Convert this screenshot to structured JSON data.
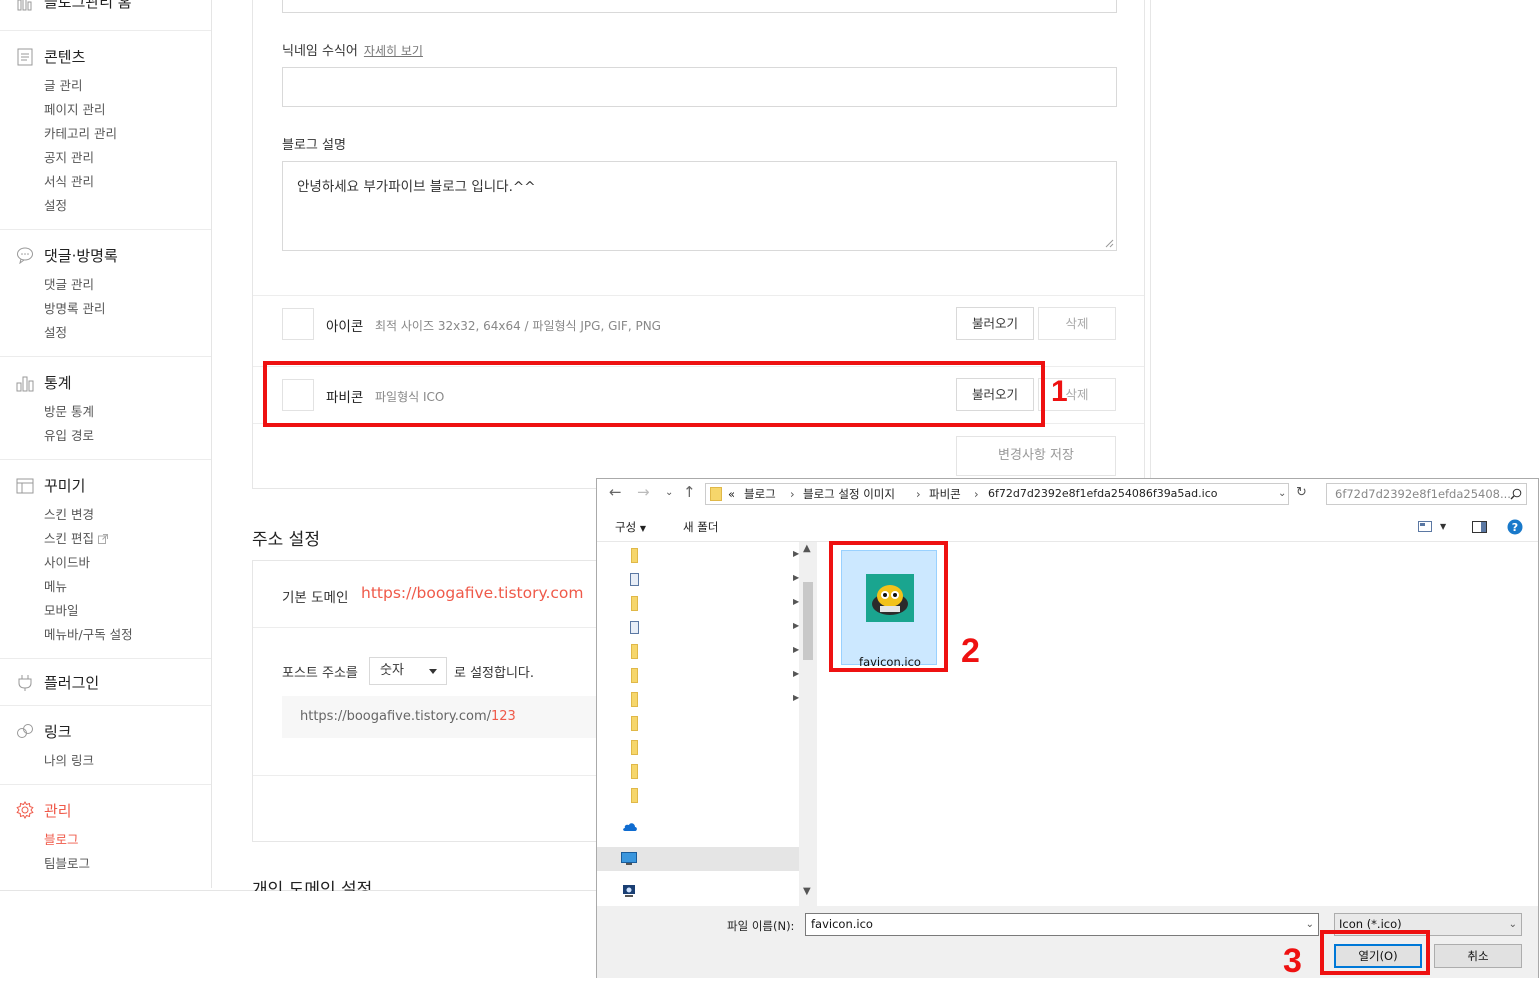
{
  "sidebar": {
    "top_cut_label": "블로그관리 홈",
    "sections": {
      "contents": {
        "title": "콘텐츠",
        "items": [
          "글 관리",
          "페이지 관리",
          "카테고리 관리",
          "공지 관리",
          "서식 관리",
          "설정"
        ]
      },
      "comments": {
        "title": "댓글·방명록",
        "items": [
          "댓글 관리",
          "방명록 관리",
          "설정"
        ]
      },
      "stats": {
        "title": "통계",
        "items": [
          "방문 통계",
          "유입 경로"
        ]
      },
      "decorate": {
        "title": "꾸미기",
        "items": [
          "스킨 변경",
          "스킨 편집",
          "사이드바",
          "메뉴",
          "모바일",
          "메뉴바/구독 설정"
        ]
      },
      "plugin": {
        "title": "플러그인"
      },
      "link": {
        "title": "링크",
        "items": [
          "나의 링크"
        ]
      },
      "manage": {
        "title": "관리",
        "items": [
          "블로그",
          "팀블로그"
        ]
      }
    }
  },
  "main": {
    "nickname_label": "닉네임 수식어",
    "nickname_detail_link": "자세히 보기",
    "nickname_value": "",
    "desc_label": "블로그 설명",
    "desc_value": "안녕하세요 부가파이브 블로그 입니다.^^",
    "icon_row": {
      "label": "아이콘",
      "desc": "최적 사이즈 32x32, 64x64 / 파일형식 JPG, GIF, PNG",
      "load_btn": "불러오기",
      "delete_btn": "삭제"
    },
    "favicon_row": {
      "label": "파비콘",
      "desc": "파일형식 ICO",
      "load_btn": "불러오기",
      "delete_btn": "삭제"
    },
    "save_btn": "변경사항 저장",
    "address_title": "주소 설정",
    "base_domain_label": "기본 도메인",
    "base_domain_value": "https://boogafive.tistory.com",
    "post_addr_label": "포스트 주소를",
    "post_addr_select": "숫자",
    "post_addr_suffix": "로 설정합니다.",
    "example_base": "https://boogafive.tistory.com/",
    "example_num": "123",
    "personal_domain_title": "개인 도메인 설정"
  },
  "annotations": {
    "step1": "1",
    "step2": "2",
    "step3": "3",
    "color": "#ee1111"
  },
  "dialog": {
    "breadcrumb": [
      "«",
      "블로그",
      "블로그 설정 이미지",
      "파비콘",
      "6f72d7d2392e8f1efda254086f39a5ad.ico"
    ],
    "search_placeholder": "6f72d7d2392e8f1efda25408...",
    "organize_label": "구성",
    "new_folder_label": "새 폴더",
    "file": {
      "name": "favicon.ico"
    },
    "filename_label": "파일 이름(N):",
    "filename_value": "favicon.ico",
    "filetype_value": "Icon (*.ico)",
    "open_btn": "열기(O)",
    "cancel_btn": "취소"
  }
}
